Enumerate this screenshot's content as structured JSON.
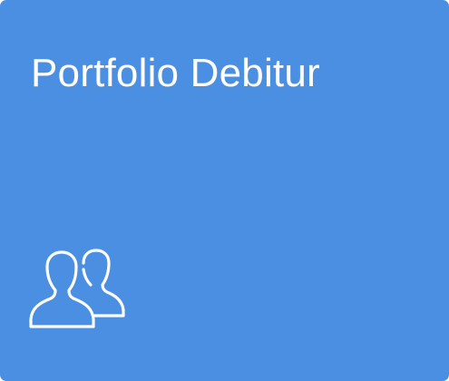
{
  "tile": {
    "title": "Portfolio Debitur",
    "icon": "users-icon",
    "background_color": "#4a8fe2",
    "text_color": "#ffffff"
  }
}
